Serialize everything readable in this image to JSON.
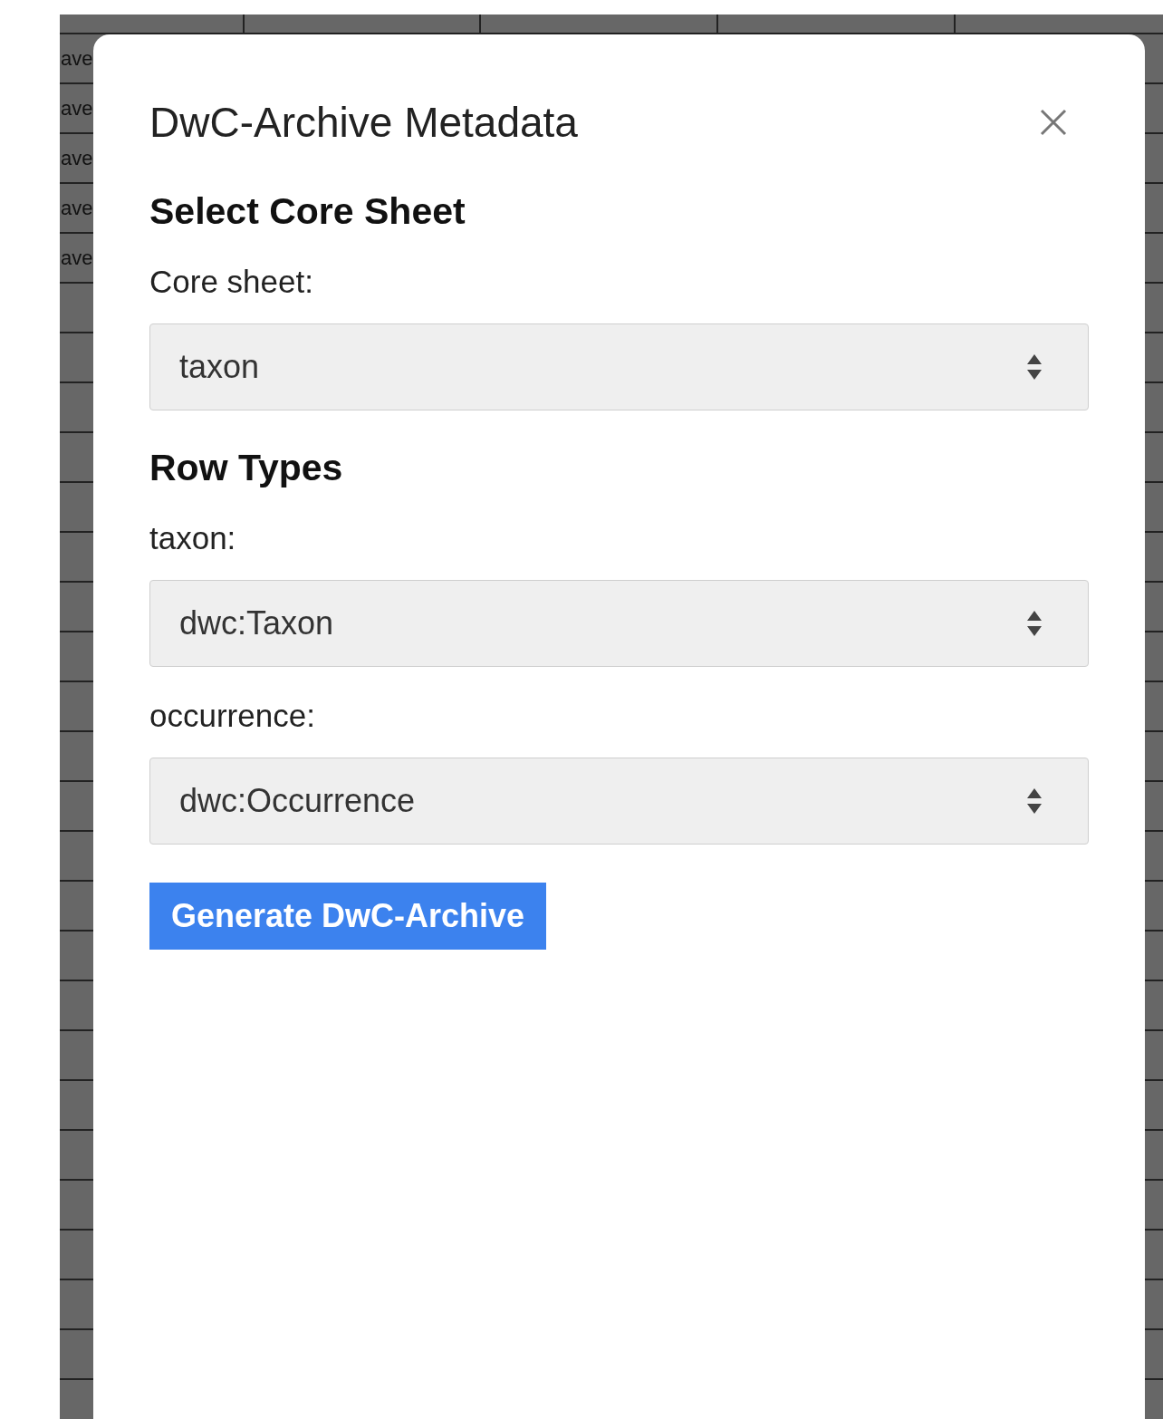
{
  "sheet": {
    "row_labels": [
      "ave",
      "ave",
      "ave",
      "ave",
      "ave"
    ]
  },
  "dialog": {
    "title": "DwC-Archive Metadata",
    "sections": [
      {
        "heading": "Select Core Sheet",
        "fields": [
          {
            "label": "Core sheet:",
            "value": "taxon"
          }
        ]
      },
      {
        "heading": "Row Types",
        "fields": [
          {
            "label": "taxon:",
            "value": "dwc:Taxon"
          },
          {
            "label": "occurrence:",
            "value": "dwc:Occurrence"
          }
        ]
      }
    ],
    "button": "Generate DwC-Archive"
  }
}
